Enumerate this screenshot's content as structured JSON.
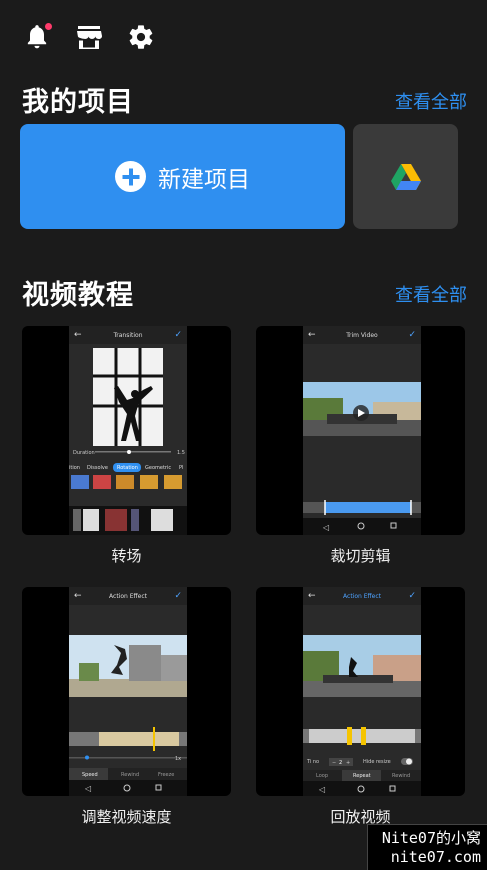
{
  "header": {
    "icons": [
      "bell-icon",
      "store-icon",
      "gear-icon"
    ]
  },
  "my_projects": {
    "title": "我的项目",
    "see_all": "查看全部",
    "new_project_label": "新建项目"
  },
  "tutorials": {
    "title": "视频教程",
    "see_all": "查看全部",
    "items": [
      {
        "label": "转场",
        "screen_title": "Transition",
        "options": [
          "ition",
          "Dissolve",
          "Rotation",
          "Geometric",
          "Pl"
        ],
        "duration_label": "Duration",
        "duration_value": "1.5"
      },
      {
        "label": "裁切剪辑",
        "screen_title": "Trim Video"
      },
      {
        "label": "调整视频速度",
        "screen_title": "Action Effect",
        "speed_value": "1x",
        "tabs": [
          "Speed",
          "Rewind",
          "Freeze"
        ]
      },
      {
        "label": "回放视频",
        "screen_title": "Action Effect",
        "tabs": [
          "Loop",
          "Repeat",
          "Rewind"
        ],
        "time_label": "Ti no",
        "count_value": "2",
        "hide_label": "Hide resize"
      }
    ]
  },
  "watermark": {
    "line1": "Nite07的小窝",
    "line2": "nite07.com"
  },
  "colors": {
    "accent": "#2f8ff0",
    "background": "#1b1b1b",
    "badge": "#ff3b6b"
  }
}
